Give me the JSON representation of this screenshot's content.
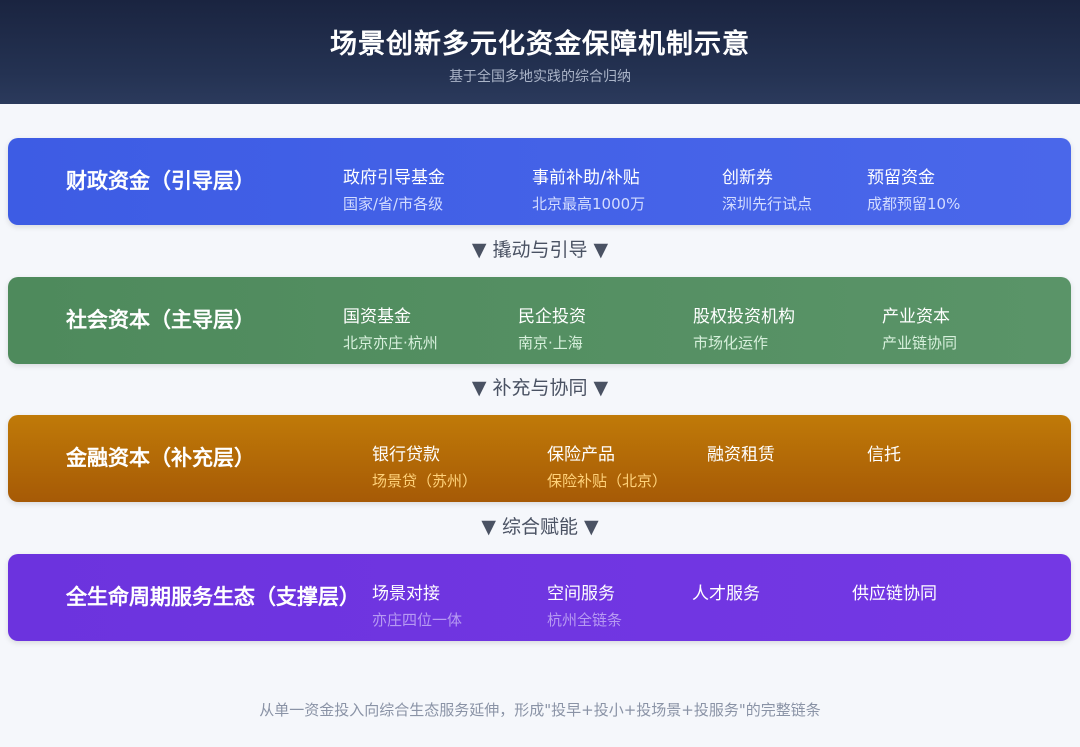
{
  "header": {
    "title": "场景创新多元化资金保障机制示意",
    "subtitle": "基于全国多地实践的综合归纳"
  },
  "colors": {
    "fiscal": "#3f5fe6",
    "social": "#4f8a5e",
    "finance": "#b8700a",
    "service": "#6f35e0"
  },
  "layers": [
    {
      "title": "财政资金（引导层）",
      "items": [
        {
          "name": "政府引导基金",
          "sub": "国家/省/市各级"
        },
        {
          "name": "事前补助/补贴",
          "sub": "北京最高1000万"
        },
        {
          "name": "创新券",
          "sub": "深圳先行试点"
        },
        {
          "name": "预留资金",
          "sub": "成都预留10%"
        }
      ]
    },
    {
      "title": "社会资本（主导层）",
      "items": [
        {
          "name": "国资基金",
          "sub": "北京亦庄·杭州"
        },
        {
          "name": "民企投资",
          "sub": "南京·上海"
        },
        {
          "name": "股权投资机构",
          "sub": "市场化运作"
        },
        {
          "name": "产业资本",
          "sub": "产业链协同"
        }
      ]
    },
    {
      "title": "金融资本（补充层）",
      "items": [
        {
          "name": "银行贷款",
          "sub": "场景贷（苏州）"
        },
        {
          "name": "保险产品",
          "sub": "保险补贴（北京）"
        },
        {
          "name": "融资租赁",
          "sub": ""
        },
        {
          "name": "信托",
          "sub": ""
        }
      ]
    },
    {
      "title": "全生命周期服务生态（支撑层）",
      "items": [
        {
          "name": "场景对接",
          "sub": "亦庄四位一体"
        },
        {
          "name": "空间服务",
          "sub": "杭州全链条"
        },
        {
          "name": "人才服务",
          "sub": ""
        },
        {
          "name": "供应链协同",
          "sub": ""
        }
      ]
    }
  ],
  "connectors": [
    "▼ 撬动与引导 ▼",
    "▼ 补充与协同 ▼",
    "▼ 综合赋能 ▼"
  ],
  "footer": "从单一资金投入向综合生态服务延伸，形成\"投早+投小+投场景+投服务\"的完整链条"
}
